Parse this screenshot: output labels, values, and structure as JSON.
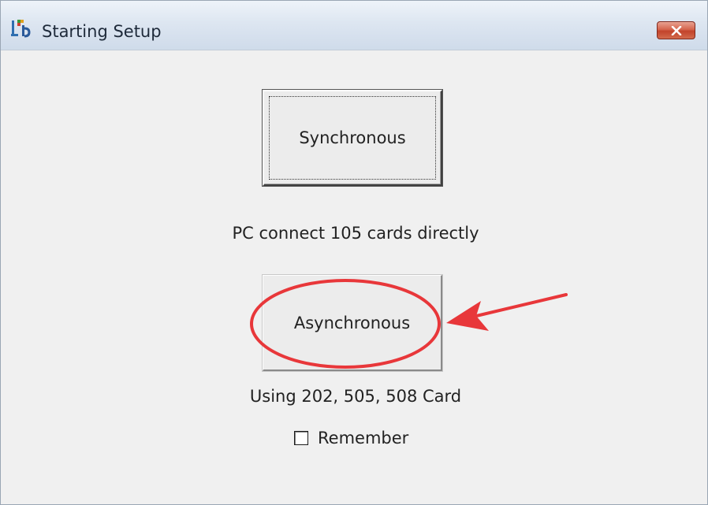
{
  "window": {
    "title": "Starting Setup",
    "close_icon": "close-icon"
  },
  "dialog": {
    "sync_button_label": "Synchronous",
    "sync_description": "PC connect 105 cards directly",
    "async_button_label": "Asynchronous",
    "async_description": "Using 202, 505, 508 Card",
    "remember_label": "Remember",
    "remember_checked": false
  },
  "annotation": {
    "color": "#e8373a",
    "shapes": [
      "ellipse-highlight",
      "arrow"
    ]
  }
}
